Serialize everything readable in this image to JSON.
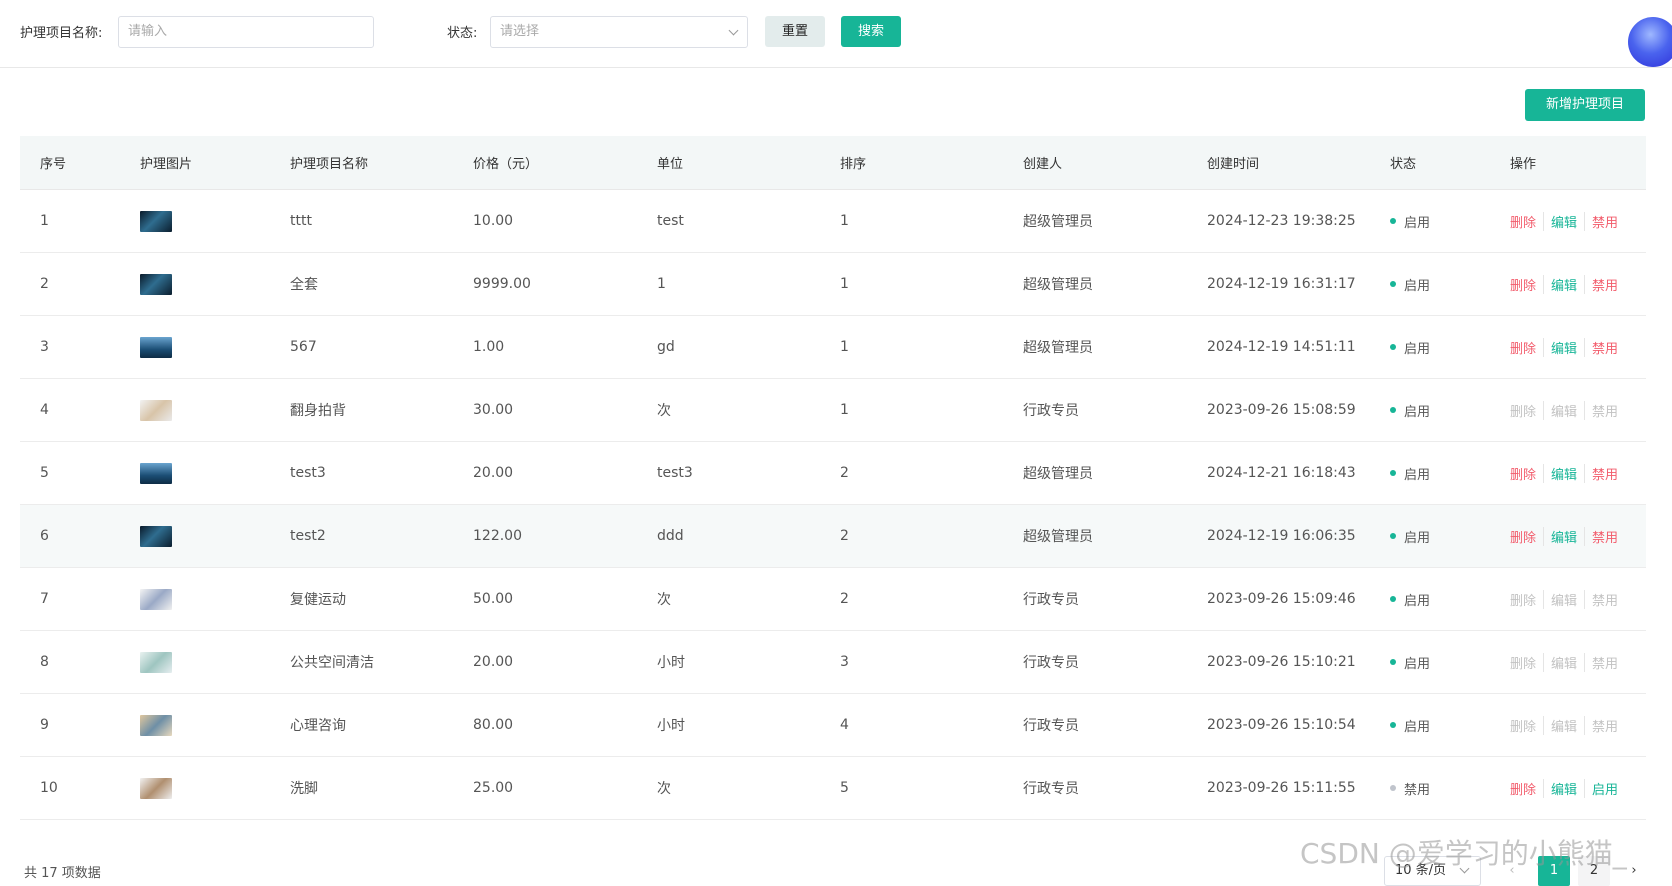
{
  "filters": {
    "name_label": "护理项目名称:",
    "name_placeholder": "请输入",
    "status_label": "状态:",
    "status_placeholder": "请选择",
    "reset_label": "重置",
    "search_label": "搜索"
  },
  "toolbar": {
    "add_label": "新增护理项目"
  },
  "table": {
    "headers": [
      "序号",
      "护理图片",
      "护理项目名称",
      "价格（元）",
      "单位",
      "排序",
      "创建人",
      "创建时间",
      "状态",
      "操作"
    ],
    "rows": [
      {
        "no": "1",
        "name": "tttt",
        "price": "10.00",
        "unit": "test",
        "sort": "1",
        "creator": "超级管理员",
        "created": "2024-12-23 19:38:25",
        "status": "启用",
        "status_color": "#17b597",
        "ops": [
          "删除",
          "编辑",
          "禁用"
        ],
        "ops_enabled": true,
        "thumb": "th-a"
      },
      {
        "no": "2",
        "name": "全套",
        "price": "9999.00",
        "unit": "1",
        "sort": "1",
        "creator": "超级管理员",
        "created": "2024-12-19 16:31:17",
        "status": "启用",
        "status_color": "#17b597",
        "ops": [
          "删除",
          "编辑",
          "禁用"
        ],
        "ops_enabled": true,
        "thumb": "th-a"
      },
      {
        "no": "3",
        "name": "567",
        "price": "1.00",
        "unit": "gd",
        "sort": "1",
        "creator": "超级管理员",
        "created": "2024-12-19 14:51:11",
        "status": "启用",
        "status_color": "#17b597",
        "ops": [
          "删除",
          "编辑",
          "禁用"
        ],
        "ops_enabled": true,
        "thumb": "th-b"
      },
      {
        "no": "4",
        "name": "翻身拍背",
        "price": "30.00",
        "unit": "次",
        "sort": "1",
        "creator": "行政专员",
        "created": "2023-09-26 15:08:59",
        "status": "启用",
        "status_color": "#17b597",
        "ops": [
          "删除",
          "编辑",
          "禁用"
        ],
        "ops_enabled": false,
        "thumb": "th-c"
      },
      {
        "no": "5",
        "name": "test3",
        "price": "20.00",
        "unit": "test3",
        "sort": "2",
        "creator": "超级管理员",
        "created": "2024-12-21 16:18:43",
        "status": "启用",
        "status_color": "#17b597",
        "ops": [
          "删除",
          "编辑",
          "禁用"
        ],
        "ops_enabled": true,
        "thumb": "th-b"
      },
      {
        "no": "6",
        "name": "test2",
        "price": "122.00",
        "unit": "ddd",
        "sort": "2",
        "creator": "超级管理员",
        "created": "2024-12-19 16:06:35",
        "status": "启用",
        "status_color": "#17b597",
        "ops": [
          "删除",
          "编辑",
          "禁用"
        ],
        "ops_enabled": true,
        "thumb": "th-a",
        "highlight": true
      },
      {
        "no": "7",
        "name": "复健运动",
        "price": "50.00",
        "unit": "次",
        "sort": "2",
        "creator": "行政专员",
        "created": "2023-09-26 15:09:46",
        "status": "启用",
        "status_color": "#17b597",
        "ops": [
          "删除",
          "编辑",
          "禁用"
        ],
        "ops_enabled": false,
        "thumb": "th-d"
      },
      {
        "no": "8",
        "name": "公共空间清洁",
        "price": "20.00",
        "unit": "小时",
        "sort": "3",
        "creator": "行政专员",
        "created": "2023-09-26 15:10:21",
        "status": "启用",
        "status_color": "#17b597",
        "ops": [
          "删除",
          "编辑",
          "禁用"
        ],
        "ops_enabled": false,
        "thumb": "th-e"
      },
      {
        "no": "9",
        "name": "心理咨询",
        "price": "80.00",
        "unit": "小时",
        "sort": "4",
        "creator": "行政专员",
        "created": "2023-09-26 15:10:54",
        "status": "启用",
        "status_color": "#17b597",
        "ops": [
          "删除",
          "编辑",
          "禁用"
        ],
        "ops_enabled": false,
        "thumb": "th-f"
      },
      {
        "no": "10",
        "name": "洗脚",
        "price": "25.00",
        "unit": "次",
        "sort": "5",
        "creator": "行政专员",
        "created": "2023-09-26 15:11:55",
        "status": "禁用",
        "status_color": "#c0c4cc",
        "ops": [
          "删除",
          "编辑",
          "启用"
        ],
        "ops_enabled": true,
        "last_op_green": true,
        "thumb": "th-g"
      }
    ]
  },
  "pagination": {
    "total_text": "共 17 项数据",
    "page_size": "10 条/页",
    "prev": "‹",
    "next": "›",
    "pages": [
      "1",
      "2"
    ],
    "current": "1"
  },
  "watermark": "CSDN @爱学习的小熊猫_"
}
